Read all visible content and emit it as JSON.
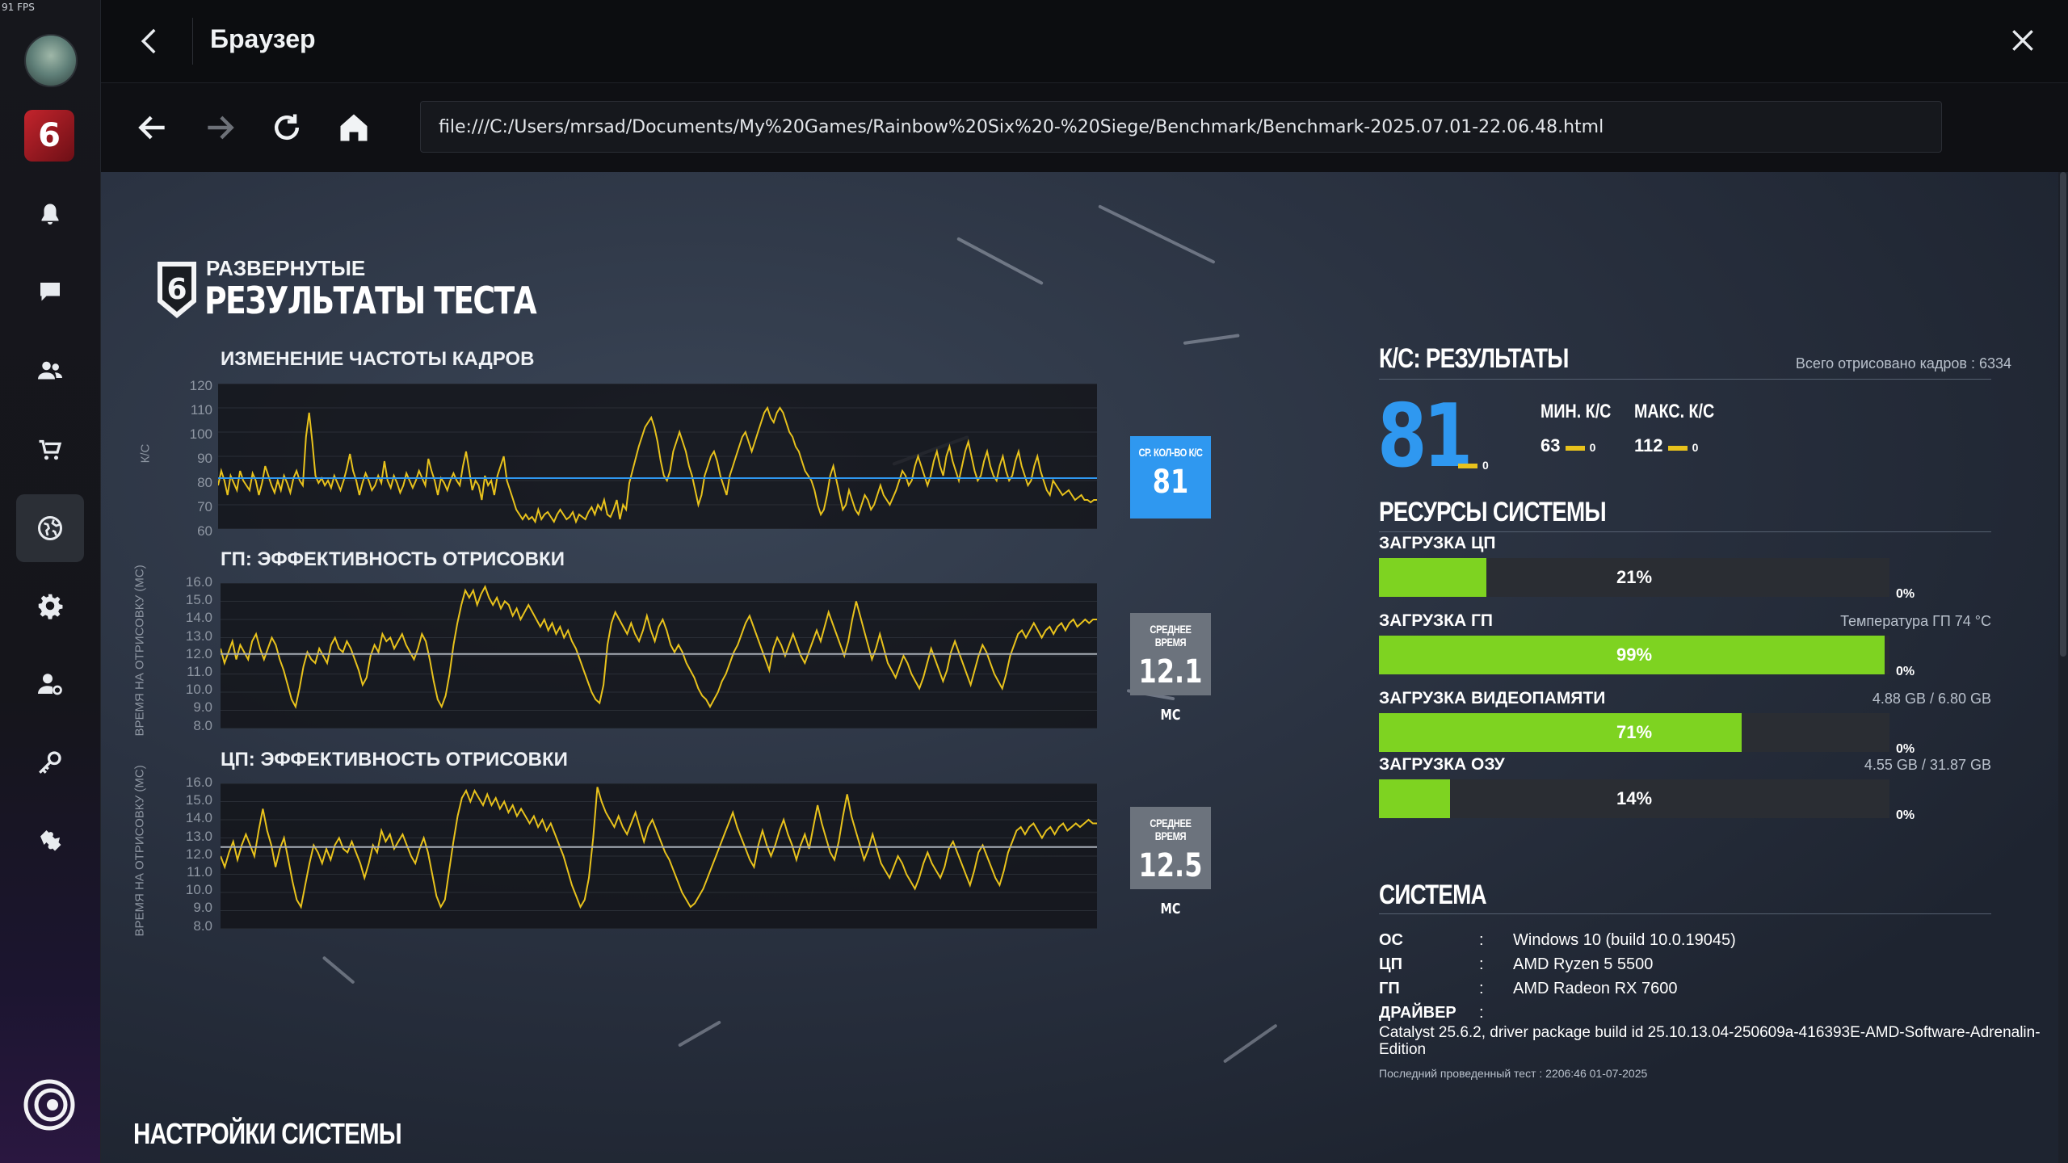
{
  "overlay": {
    "fps_counter": "91 FPS"
  },
  "titlebar": {
    "title": "Браузер"
  },
  "navbar": {
    "url": "file:///C:/Users/mrsad/Documents/My%20Games/Rainbow%20Six%20-%20Siege/Benchmark/Benchmark-2025.07.01-22.06.48.html"
  },
  "report": {
    "heading_small": "РАЗВЕРНУТЫЕ",
    "heading_big": "РЕЗУЛЬТАТЫ ТЕСТА",
    "badge_number": "6",
    "game_tile_label": "6"
  },
  "charts": [
    {
      "title": "ИЗМЕНЕНИЕ ЧАСТОТЫ КАДРОВ",
      "ylabel": "К/С",
      "ticks": [
        "120",
        "110",
        "100",
        "90",
        "80",
        "70",
        "60"
      ],
      "stat_label": "СР. КОЛ-ВО К/С",
      "stat_value": "81",
      "stat_unit": ""
    },
    {
      "title": "ГП: ЭФФЕКТИВНОСТЬ ОТРИСОВКИ",
      "ylabel": "ВРЕМЯ НА ОТРИСОВКУ (МС)",
      "ticks": [
        "16.0",
        "15.0",
        "14.0",
        "13.0",
        "12.0",
        "11.0",
        "10.0",
        "9.0",
        "8.0"
      ],
      "stat_label": "СРЕДНЕЕ ВРЕМЯ",
      "stat_value": "12.1",
      "stat_unit": "МС"
    },
    {
      "title": "ЦП: ЭФФЕКТИВНОСТЬ ОТРИСОВКИ",
      "ylabel": "ВРЕМЯ НА ОТРИСОВКУ (МС)",
      "ticks": [
        "16.0",
        "15.0",
        "14.0",
        "13.0",
        "12.0",
        "11.0",
        "10.0",
        "9.0",
        "8.0"
      ],
      "stat_label": "СРЕДНЕЕ ВРЕМЯ",
      "stat_value": "12.5",
      "stat_unit": "МС"
    }
  ],
  "chart_data": [
    {
      "type": "line",
      "title": "ИЗМЕНЕНИЕ ЧАСТОТЫ КАДРОВ",
      "ylabel": "К/С",
      "ylim": [
        60,
        120
      ],
      "mean": 81,
      "y": [
        78,
        84,
        80,
        74,
        82,
        79,
        76,
        84,
        80,
        78,
        76,
        83,
        80,
        74,
        79,
        86,
        82,
        78,
        75,
        80,
        76,
        82,
        79,
        75,
        81,
        84,
        80,
        78,
        98,
        108,
        96,
        82,
        79,
        81,
        78,
        80,
        77,
        82,
        79,
        76,
        80,
        85,
        91,
        84,
        80,
        74,
        79,
        83,
        80,
        76,
        78,
        82,
        79,
        88,
        80,
        77,
        82,
        79,
        75,
        78,
        83,
        80,
        77,
        80,
        84,
        81,
        78,
        89,
        84,
        80,
        74,
        81,
        79,
        76,
        80,
        83,
        80,
        78,
        86,
        92,
        84,
        76,
        80,
        78,
        72,
        82,
        78,
        80,
        74,
        82,
        86,
        90,
        80,
        76,
        72,
        68,
        66,
        64,
        66,
        64,
        65,
        63,
        68,
        64,
        66,
        67,
        65,
        63,
        66,
        68,
        66,
        64,
        65,
        67,
        63,
        66,
        65,
        64,
        67,
        69,
        66,
        70,
        68,
        72,
        66,
        65,
        68,
        72,
        64,
        70,
        68,
        79,
        84,
        89,
        94,
        98,
        102,
        104,
        106,
        102,
        96,
        88,
        82,
        80,
        84,
        92,
        96,
        100,
        96,
        92,
        86,
        82,
        76,
        70,
        74,
        82,
        86,
        90,
        92,
        88,
        82,
        78,
        74,
        82,
        86,
        90,
        94,
        98,
        100,
        96,
        92,
        96,
        100,
        104,
        108,
        110,
        106,
        104,
        108,
        110,
        108,
        104,
        100,
        98,
        94,
        92,
        88,
        84,
        82,
        80,
        76,
        70,
        66,
        68,
        74,
        82,
        86,
        80,
        74,
        68,
        70,
        76,
        72,
        68,
        66,
        70,
        74,
        72,
        68,
        70,
        74,
        78,
        74,
        72,
        70,
        73,
        76,
        80,
        84,
        82,
        78,
        80,
        86,
        90,
        86,
        82,
        78,
        82,
        88,
        92,
        86,
        82,
        90,
        94,
        88,
        84,
        80,
        86,
        92,
        96,
        90,
        84,
        80,
        82,
        88,
        92,
        86,
        82,
        80,
        86,
        90,
        84,
        80,
        82,
        88,
        92,
        86,
        82,
        78,
        80,
        86,
        90,
        84,
        80,
        76,
        74,
        80,
        78,
        76,
        74,
        75,
        76,
        74,
        72,
        73,
        74,
        72,
        72,
        71,
        72,
        72
      ]
    },
    {
      "type": "line",
      "title": "ГП: ЭФФЕКТИВНОСТЬ ОТРИСОВКИ",
      "ylabel": "ВРЕМЯ НА ОТРИСОВКУ (МС)",
      "ylim": [
        8,
        16
      ],
      "mean": 12.1,
      "y": [
        12.4,
        11.6,
        12.2,
        12.8,
        11.8,
        12.6,
        12.2,
        11.8,
        12.8,
        13.2,
        12.4,
        11.8,
        12.4,
        13.0,
        12.6,
        11.8,
        11.2,
        10.4,
        9.6,
        9.2,
        10.2,
        11.4,
        12.2,
        11.8,
        11.6,
        12.4,
        12.0,
        11.6,
        12.6,
        13.0,
        12.4,
        12.2,
        12.8,
        12.4,
        11.8,
        11.2,
        10.4,
        10.8,
        12.0,
        12.6,
        12.2,
        13.2,
        12.8,
        13.0,
        12.4,
        12.8,
        13.2,
        12.6,
        12.2,
        11.8,
        12.4,
        13.2,
        12.8,
        11.8,
        10.6,
        9.6,
        9.2,
        9.8,
        11.0,
        12.6,
        13.8,
        14.8,
        15.6,
        15.2,
        15.6,
        14.8,
        15.4,
        15.8,
        15.2,
        14.8,
        15.2,
        14.6,
        15.0,
        14.8,
        14.2,
        14.6,
        14.0,
        14.4,
        14.8,
        14.4,
        14.0,
        13.6,
        14.0,
        13.4,
        13.8,
        13.2,
        13.6,
        13.0,
        13.4,
        12.8,
        12.4,
        11.8,
        11.2,
        10.6,
        10.0,
        9.6,
        9.4,
        10.4,
        12.6,
        13.8,
        14.4,
        14.0,
        13.6,
        13.2,
        13.8,
        13.2,
        12.8,
        13.4,
        14.2,
        13.4,
        12.8,
        13.6,
        14.0,
        13.4,
        12.6,
        12.2,
        12.6,
        12.2,
        11.6,
        11.2,
        10.8,
        10.2,
        9.8,
        9.6,
        9.2,
        9.6,
        10.0,
        10.6,
        11.0,
        11.6,
        12.2,
        12.6,
        13.2,
        13.8,
        14.2,
        13.6,
        13.0,
        12.4,
        11.8,
        11.2,
        12.4,
        13.0,
        12.6,
        12.0,
        12.6,
        13.2,
        12.6,
        12.0,
        11.6,
        12.2,
        12.8,
        13.4,
        12.8,
        13.6,
        14.4,
        13.8,
        13.2,
        12.6,
        12.0,
        12.8,
        14.0,
        15.0,
        14.2,
        13.4,
        12.6,
        11.8,
        12.4,
        13.2,
        12.4,
        11.6,
        11.2,
        10.8,
        11.4,
        12.0,
        11.6,
        11.0,
        10.6,
        10.2,
        10.8,
        11.6,
        12.4,
        11.8,
        11.2,
        10.6,
        11.2,
        12.2,
        12.8,
        12.2,
        11.6,
        11.0,
        10.4,
        11.2,
        12.0,
        12.6,
        12.2,
        11.6,
        11.0,
        10.6,
        10.2,
        11.0,
        12.0,
        12.6,
        13.2,
        13.4,
        13.0,
        13.4,
        13.8,
        13.4,
        13.0,
        13.4,
        13.6,
        13.2,
        13.6,
        13.8,
        13.4,
        13.8,
        14.0,
        13.6,
        13.8,
        14.0,
        13.8,
        14.0,
        14.0
      ]
    },
    {
      "type": "line",
      "title": "ЦП: ЭФФЕКТИВНОСТЬ ОТРИСОВКИ",
      "ylabel": "ВРЕМЯ НА ОТРИСОВКУ (МС)",
      "ylim": [
        8,
        16
      ],
      "mean": 12.5,
      "y": [
        12.0,
        11.4,
        12.2,
        12.8,
        11.8,
        12.6,
        13.2,
        12.6,
        12.0,
        13.4,
        14.6,
        13.4,
        12.6,
        11.4,
        12.4,
        13.0,
        11.8,
        10.6,
        9.6,
        9.2,
        10.4,
        11.6,
        12.6,
        12.2,
        11.6,
        12.4,
        11.8,
        12.6,
        13.0,
        12.4,
        12.2,
        12.8,
        12.2,
        11.6,
        10.8,
        11.6,
        12.6,
        12.2,
        13.4,
        12.8,
        13.2,
        12.4,
        12.8,
        13.2,
        12.6,
        12.0,
        11.6,
        12.4,
        13.0,
        12.2,
        11.0,
        9.8,
        9.2,
        9.6,
        11.2,
        12.8,
        14.2,
        15.2,
        15.6,
        15.0,
        15.6,
        15.2,
        14.8,
        15.4,
        14.8,
        15.2,
        14.6,
        15.0,
        14.4,
        14.8,
        14.2,
        14.6,
        14.2,
        13.8,
        14.2,
        13.6,
        14.0,
        13.4,
        13.8,
        13.2,
        12.6,
        12.0,
        11.2,
        10.4,
        9.8,
        9.2,
        9.6,
        10.8,
        13.0,
        15.8,
        15.0,
        14.4,
        14.0,
        13.6,
        14.2,
        13.6,
        13.2,
        13.8,
        14.4,
        13.6,
        12.8,
        13.6,
        14.0,
        13.4,
        12.8,
        12.2,
        11.8,
        11.2,
        10.6,
        10.0,
        9.6,
        9.2,
        9.4,
        9.8,
        10.2,
        10.8,
        11.4,
        12.0,
        12.6,
        13.2,
        13.8,
        14.4,
        13.6,
        13.0,
        12.4,
        11.8,
        11.4,
        12.6,
        13.4,
        12.6,
        12.0,
        12.6,
        13.4,
        14.0,
        13.2,
        12.6,
        11.8,
        12.6,
        13.2,
        12.4,
        13.6,
        14.8,
        13.8,
        13.0,
        12.2,
        11.8,
        12.8,
        14.2,
        15.4,
        14.2,
        13.4,
        12.6,
        11.8,
        12.4,
        13.2,
        12.4,
        11.6,
        11.2,
        10.8,
        11.4,
        12.0,
        11.6,
        11.0,
        10.6,
        10.2,
        10.8,
        11.6,
        12.2,
        11.6,
        11.2,
        10.8,
        11.4,
        12.4,
        12.8,
        12.2,
        11.6,
        11.0,
        10.4,
        11.2,
        12.2,
        12.6,
        12.0,
        11.4,
        10.8,
        10.4,
        11.2,
        12.2,
        12.8,
        13.4,
        13.6,
        13.2,
        13.6,
        13.8,
        13.4,
        13.0,
        13.4,
        13.6,
        13.2,
        13.6,
        13.8,
        13.4,
        13.6,
        13.8,
        13.6,
        13.8,
        14.0,
        13.8,
        13.8
      ]
    }
  ],
  "fps_results": {
    "heading": "К/С: РЕЗУЛЬТАТЫ",
    "total_frames": "Всего отрисовано кадров : 6334",
    "avg": "81",
    "avg_delta": "0",
    "min_label": "МИН. К/С",
    "max_label": "МАКС. К/С",
    "min": "63",
    "min_delta": "0",
    "max": "112",
    "max_delta": "0",
    "delta_color": "#e8c21c",
    "avg_color": "#2f98f0"
  },
  "resources": {
    "heading": "РЕСУРСЫ СИСТЕМЫ",
    "bar_color": "#7ed321",
    "items": [
      {
        "label": "ЗАГРУЗКА ЦП",
        "right": "",
        "pct_text": "21%",
        "pct": 21,
        "zero": "0%"
      },
      {
        "label": "ЗАГРУЗКА ГП",
        "right": "Температура ГП 74 °C",
        "pct_text": "99%",
        "pct": 99,
        "zero": "0%"
      },
      {
        "label": "ЗАГРУЗКА ВИДЕОПАМЯТИ",
        "right": "4.88 GB / 6.80 GB",
        "pct_text": "71%",
        "pct": 71,
        "zero": "0%"
      },
      {
        "label": "ЗАГРУЗКА ОЗУ",
        "right": "4.55 GB / 31.87 GB",
        "pct_text": "14%",
        "pct": 14,
        "zero": "0%"
      }
    ]
  },
  "system": {
    "heading": "СИСТЕМА",
    "rows": [
      {
        "key": "ОС",
        "colon": ":",
        "value": "Windows 10 (build 10.0.19045)"
      },
      {
        "key": "ЦП",
        "colon": ":",
        "value": "AMD Ryzen 5 5500"
      },
      {
        "key": "ГП",
        "colon": ":",
        "value": "AMD Radeon RX 7600"
      },
      {
        "key": "ДРАЙВЕР",
        "colon": ":",
        "value": ""
      }
    ],
    "driver": "Catalyst 25.6.2, driver package build id 25.10.13.04-250609a-416393E-AMD-Software-Adrenalin-Edition",
    "last_test": "Последний проведенный тест : 2206:46 01-07-2025"
  },
  "settings": {
    "heading": "НАСТРОЙКИ СИСТЕМЫ"
  },
  "icons": {
    "sidebar": [
      "bell-icon",
      "chat-icon",
      "friends-icon",
      "cart-icon",
      "globe-icon",
      "gear-icon",
      "account-icon",
      "key-icon",
      "puzzle-icon"
    ],
    "nav": [
      "back-arrow-icon",
      "forward-arrow-icon",
      "reload-icon",
      "home-icon"
    ]
  }
}
